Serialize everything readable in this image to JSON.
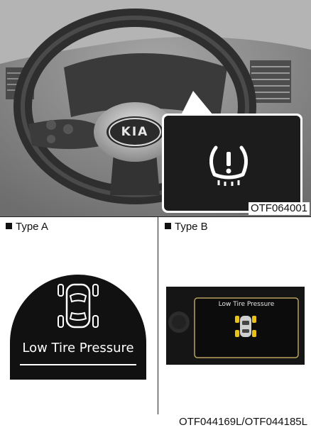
{
  "photo": {
    "code": "OTF064001",
    "logo_text": "KIA",
    "warning_icon": "tpms-warning-icon"
  },
  "type_a": {
    "label": "Type A",
    "display_text": "Low Tire Pressure"
  },
  "type_b": {
    "label": "Type B",
    "display_text": "Low Tire Pressure"
  },
  "bottom_code": "OTF044169L/OTF044185L",
  "colors": {
    "display_bg": "#111111",
    "tire_warning": "#e8c21a",
    "frame_gold": "#b8a060"
  }
}
